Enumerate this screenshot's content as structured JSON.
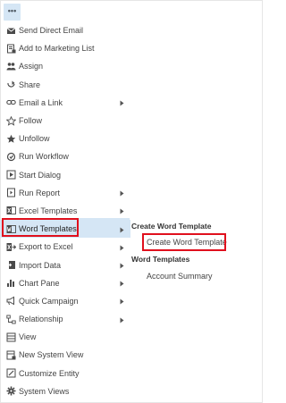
{
  "toolbar": {
    "more_label": "•••"
  },
  "menu_items": [
    {
      "label": "Send Direct Email",
      "icon": "envelope-icon",
      "has_submenu": false
    },
    {
      "label": "Add to Marketing List",
      "icon": "list-add-icon",
      "has_submenu": false
    },
    {
      "label": "Assign",
      "icon": "assign-people-icon",
      "has_submenu": false
    },
    {
      "label": "Share",
      "icon": "share-icon",
      "has_submenu": false
    },
    {
      "label": "Email a Link",
      "icon": "link-icon",
      "has_submenu": true
    },
    {
      "label": "Follow",
      "icon": "star-outline-icon",
      "has_submenu": false
    },
    {
      "label": "Unfollow",
      "icon": "star-filled-icon",
      "has_submenu": false
    },
    {
      "label": "Run Workflow",
      "icon": "workflow-icon",
      "has_submenu": false
    },
    {
      "label": "Start Dialog",
      "icon": "dialog-icon",
      "has_submenu": false
    },
    {
      "label": "Run Report",
      "icon": "report-icon",
      "has_submenu": true
    },
    {
      "label": "Excel Templates",
      "icon": "excel-icon",
      "has_submenu": true
    },
    {
      "label": "Word Templates",
      "icon": "word-icon",
      "has_submenu": true,
      "active": true
    },
    {
      "label": "Export to Excel",
      "icon": "export-excel-icon",
      "has_submenu": true
    },
    {
      "label": "Import Data",
      "icon": "import-icon",
      "has_submenu": true
    },
    {
      "label": "Chart Pane",
      "icon": "chart-icon",
      "has_submenu": true
    },
    {
      "label": "Quick Campaign",
      "icon": "campaign-icon",
      "has_submenu": true
    },
    {
      "label": "Relationship",
      "icon": "relationship-icon",
      "has_submenu": true
    },
    {
      "label": "View",
      "icon": "view-icon",
      "has_submenu": false
    },
    {
      "label": "New System View",
      "icon": "new-view-icon",
      "has_submenu": false
    },
    {
      "label": "Customize Entity",
      "icon": "customize-icon",
      "has_submenu": false
    },
    {
      "label": "System Views",
      "icon": "gear-icon",
      "has_submenu": false
    }
  ],
  "submenu": {
    "create_header": "Create Word Template",
    "create_item": "Create Word Template",
    "templates_header": "Word Templates",
    "template_item": "Account Summary"
  },
  "colors": {
    "highlight": "#d5e6f5",
    "callout_border": "#e0101d",
    "text": "#444444"
  }
}
